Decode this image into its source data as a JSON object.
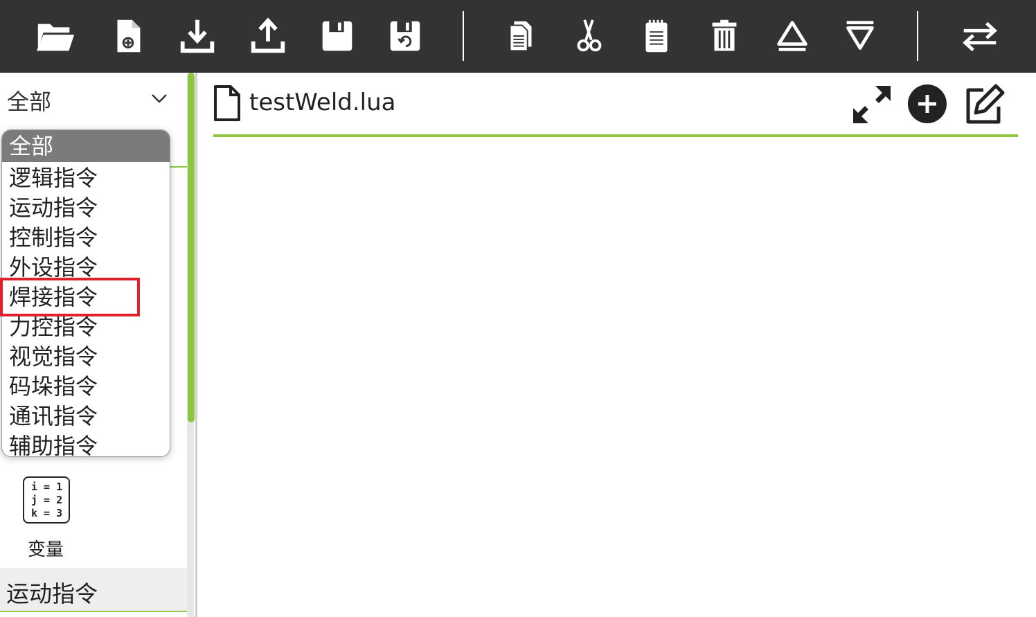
{
  "toolbar": {
    "buttons": [
      {
        "icon": "open-folder-icon"
      },
      {
        "icon": "new-file-icon"
      },
      {
        "icon": "download-icon"
      },
      {
        "icon": "upload-icon"
      },
      {
        "icon": "save-icon"
      },
      {
        "icon": "save-as-icon"
      },
      {
        "icon": "copy-icon"
      },
      {
        "icon": "cut-icon"
      },
      {
        "icon": "paste-icon"
      },
      {
        "icon": "delete-icon"
      },
      {
        "icon": "move-up-icon"
      },
      {
        "icon": "move-down-icon"
      },
      {
        "icon": "swap-icon"
      }
    ],
    "background": "#333333"
  },
  "sidebar": {
    "category_select": {
      "value": "全部"
    },
    "dropdown": {
      "selected": "全部",
      "options": [
        "逻辑指令",
        "运动指令",
        "控制指令",
        "外设指令",
        "焊接指令",
        "力控指令",
        "视觉指令",
        "码垛指令",
        "通讯指令",
        "辅助指令"
      ],
      "highlighted_option": "焊接指令"
    },
    "variable_tile": {
      "lines": [
        "i = 1",
        "j = 2",
        "k = 3"
      ],
      "label": "变量"
    },
    "section_header": "运动指令"
  },
  "editor": {
    "file_name": "testWeld.lua",
    "header_icons": [
      "expand-icon",
      "add-circle-icon",
      "edit-icon"
    ]
  },
  "colors": {
    "accent": "#8dc63f",
    "highlight": "#e0202c",
    "selected_option_bg": "#7b7b7b"
  }
}
